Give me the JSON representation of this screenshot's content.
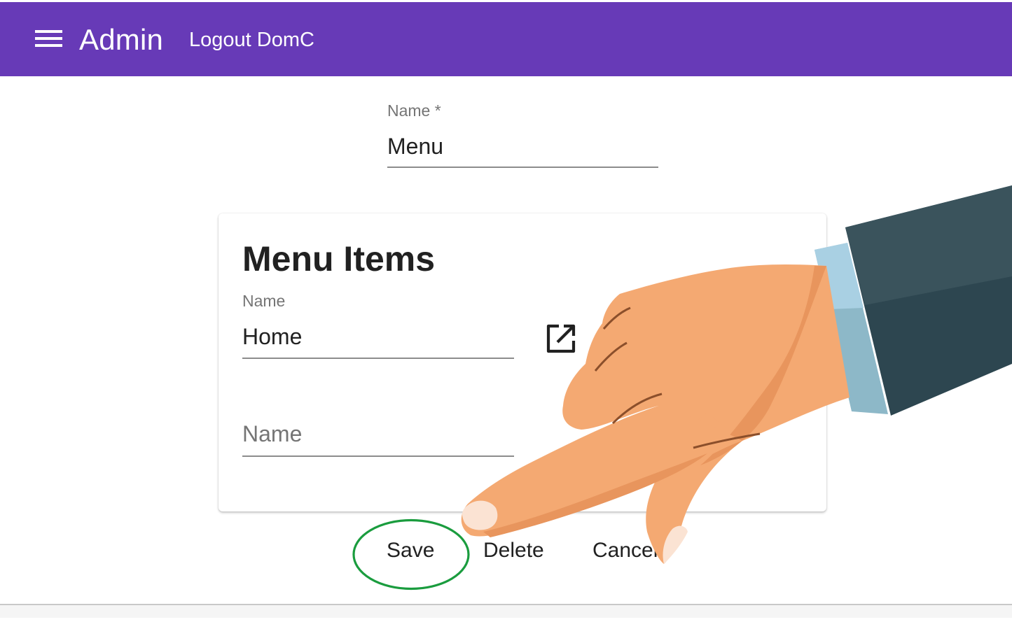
{
  "appbar": {
    "title": "Admin",
    "logout_label": "Logout DomC",
    "color": "#673ab7",
    "menu_icon": "hamburger-menu-icon"
  },
  "form": {
    "name_label": "Name *",
    "name_value": "Menu"
  },
  "menu_items_card": {
    "title": "Menu Items",
    "items": [
      {
        "label": "Name",
        "value": "Home",
        "action_icon": "open-in-new-icon"
      }
    ],
    "new_item_placeholder": "Name"
  },
  "actions": {
    "save_label": "Save",
    "delete_label": "Delete",
    "cancel_label": "Cancel"
  },
  "annotation": {
    "highlight_color": "#1a9c3e",
    "pointer": "pointing-hand-illustration"
  }
}
